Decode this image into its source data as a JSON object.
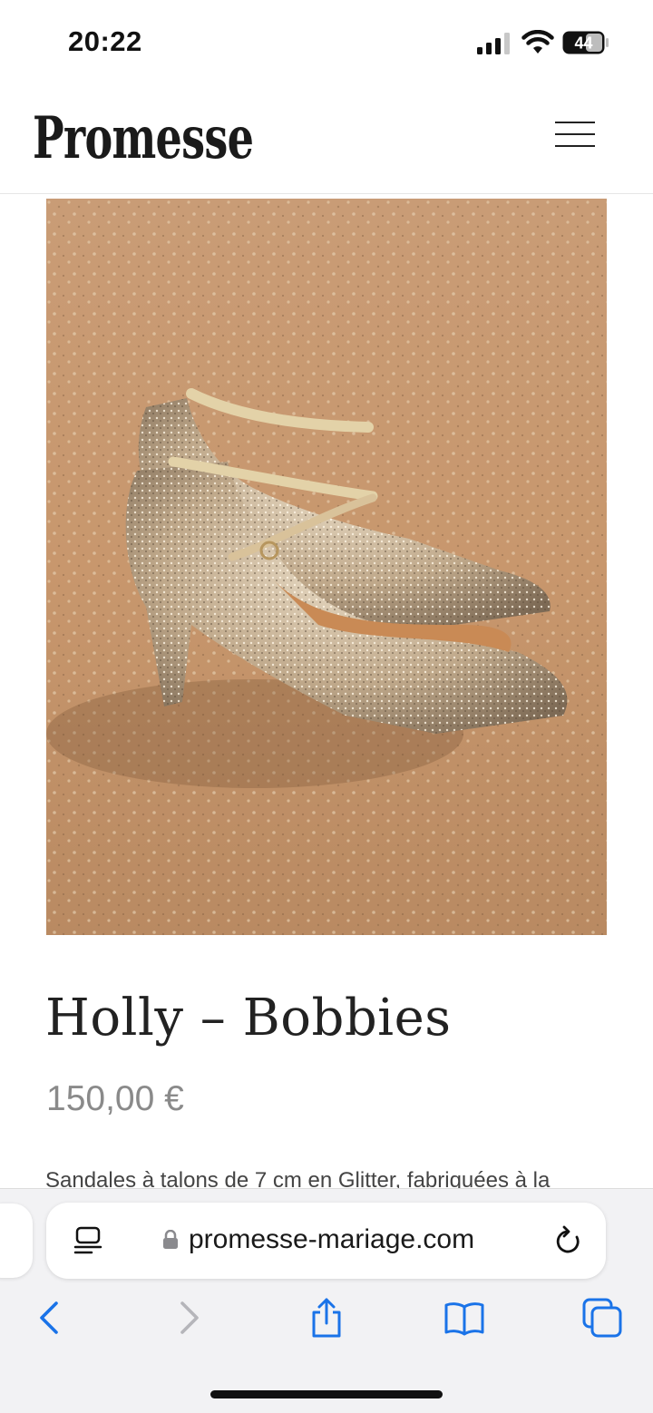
{
  "status_bar": {
    "time": "20:22",
    "battery": "44"
  },
  "header": {
    "logo": "Promesse"
  },
  "product": {
    "title": "Holly – Bobbies",
    "price": "150,00 €",
    "description": "Sandales à talons de 7 cm en Glitter, fabriquées à la"
  },
  "browser": {
    "url": "promesse-mariage.com"
  },
  "colors": {
    "accent": "#1a73e8",
    "price": "#8a8a8a",
    "toolbar_bg": "#f2f2f4"
  }
}
